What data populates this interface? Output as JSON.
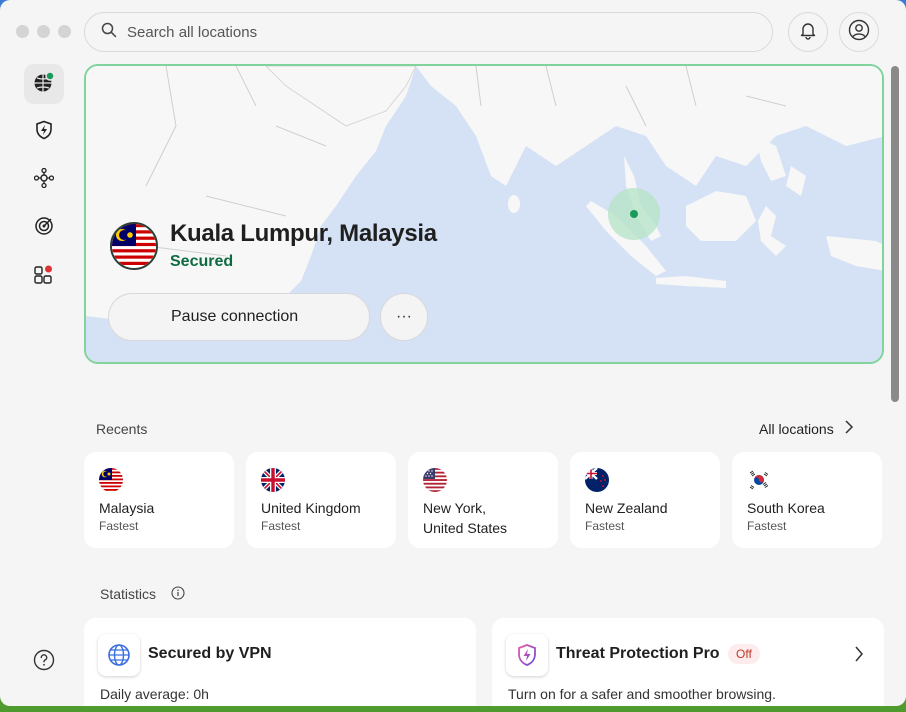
{
  "search": {
    "placeholder": "Search all locations"
  },
  "connection": {
    "location": "Kuala Lumpur, Malaysia",
    "status": "Secured",
    "pause_label": "Pause connection",
    "more_label": "···"
  },
  "recents": {
    "label": "Recents",
    "all_locations": "All locations",
    "items": [
      {
        "name": "Malaysia",
        "sub": "Fastest",
        "flag": "malaysia-flag-icon"
      },
      {
        "name": "United Kingdom",
        "sub": "Fastest",
        "flag": "uk-flag-icon"
      },
      {
        "name": "New York, United States",
        "sub": "",
        "flag": "us-flag-icon"
      },
      {
        "name": "New Zealand",
        "sub": "Fastest",
        "flag": "nz-flag-icon"
      },
      {
        "name": "South Korea",
        "sub": "Fastest",
        "flag": "korea-flag-icon"
      }
    ]
  },
  "statistics": {
    "label": "Statistics",
    "vpn": {
      "title": "Secured by VPN",
      "sub": "Daily average: 0h"
    },
    "threat": {
      "title": "Threat Protection Pro",
      "badge": "Off",
      "sub": "Turn on for a safer and smoother browsing."
    }
  },
  "colors": {
    "accent": "#0d6b3f",
    "border_active": "#7fd39b",
    "map_water": "#d5e2f5",
    "badge_red": "#c0392b"
  }
}
